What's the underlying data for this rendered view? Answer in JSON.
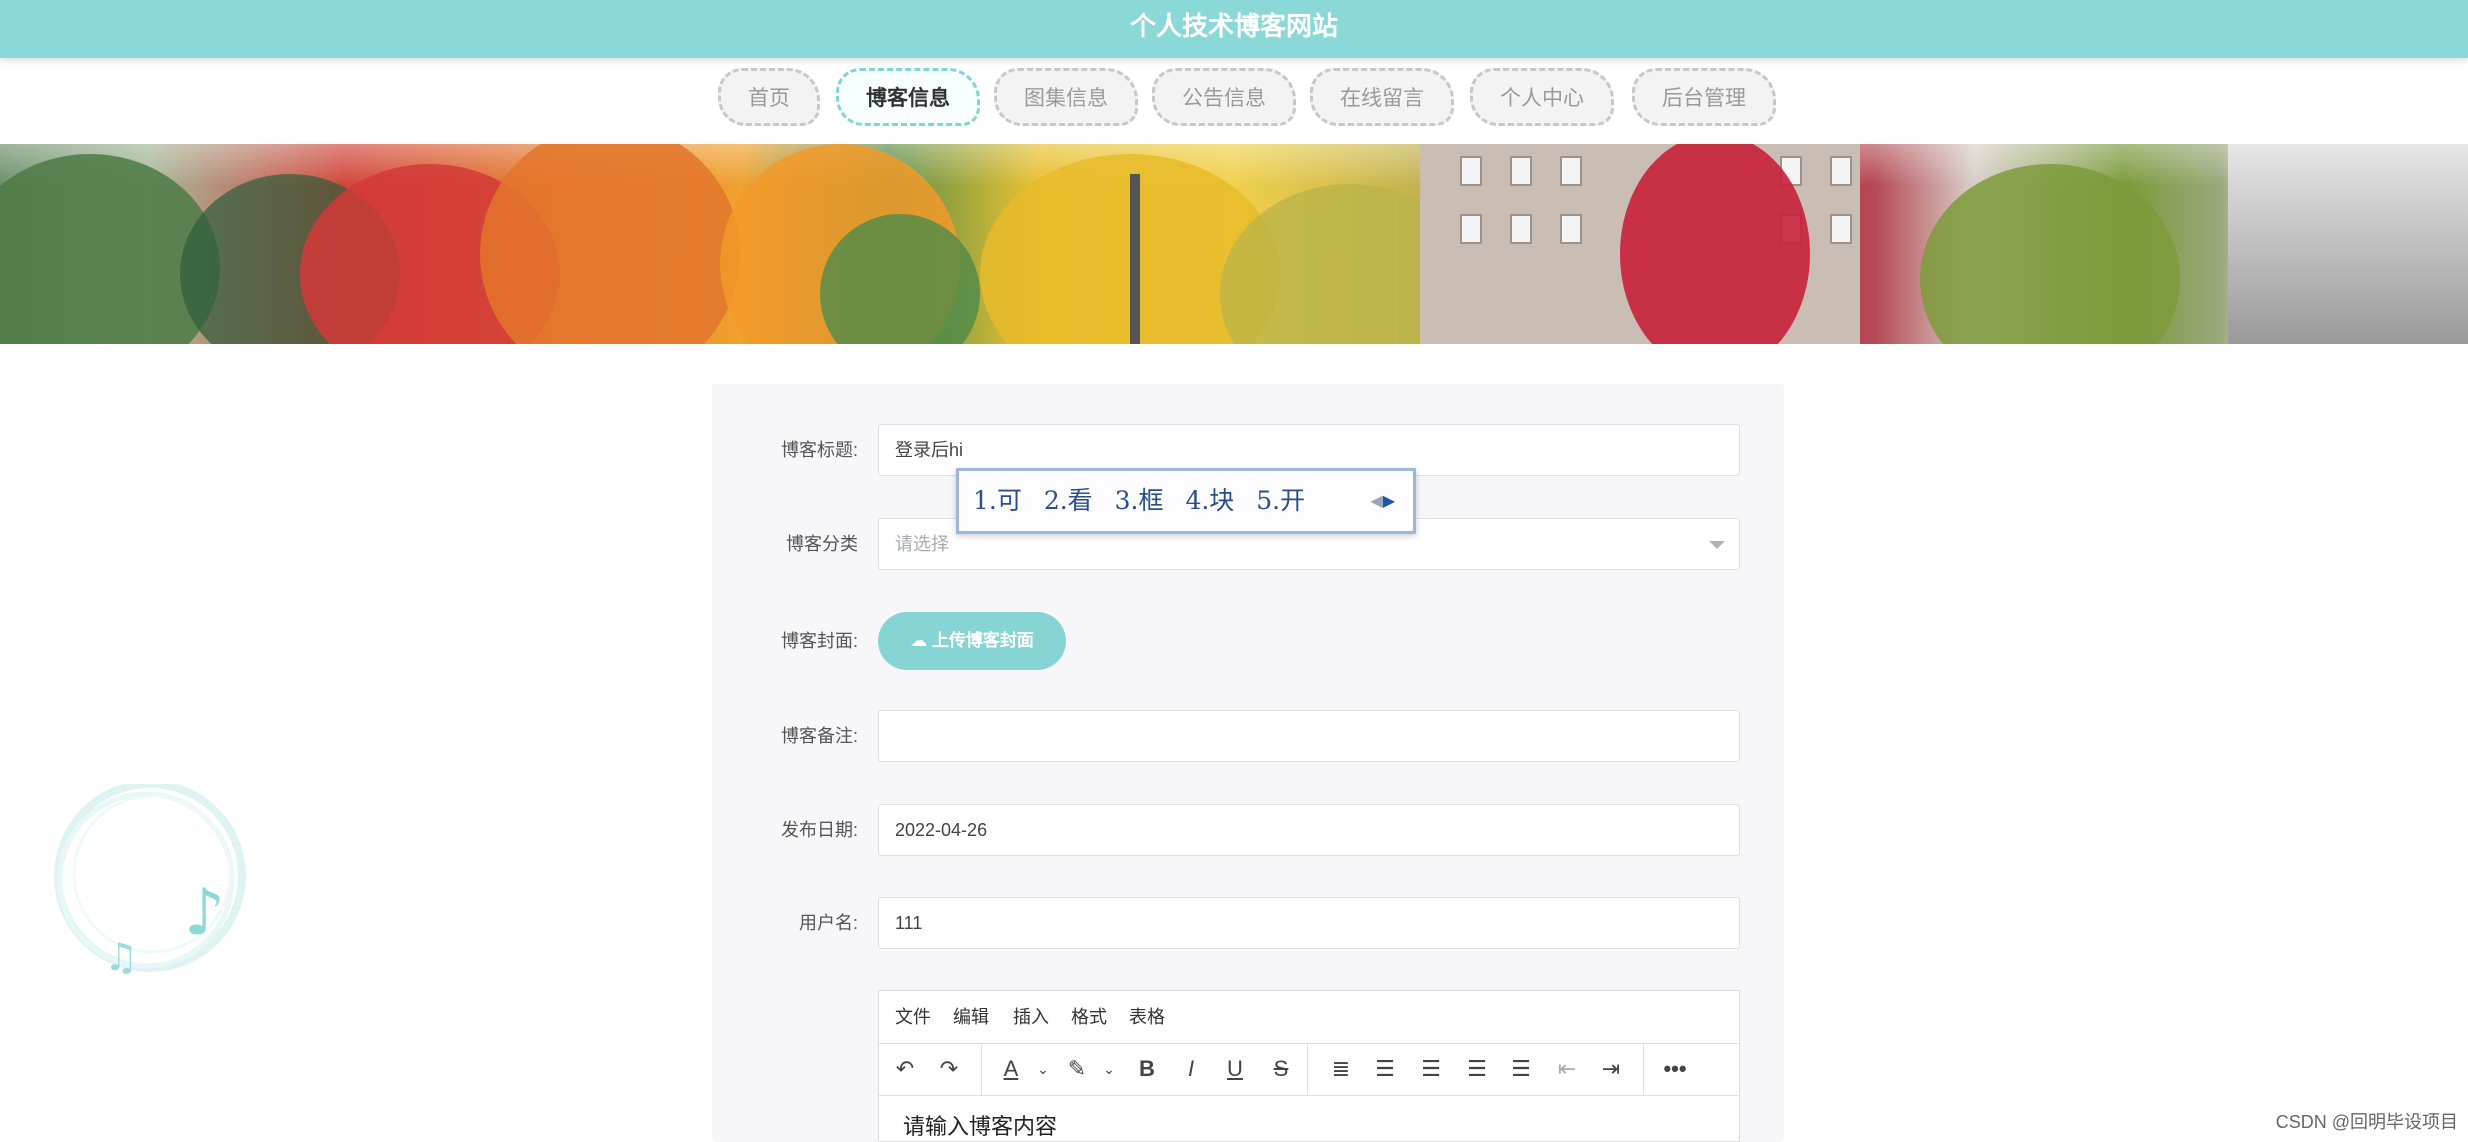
{
  "site": {
    "title": "个人技术博客网站"
  },
  "nav": {
    "items": [
      {
        "label": "首页"
      },
      {
        "label": "博客信息"
      },
      {
        "label": "图集信息"
      },
      {
        "label": "公告信息"
      },
      {
        "label": "在线留言"
      },
      {
        "label": "个人中心"
      },
      {
        "label": "后台管理"
      }
    ],
    "active": "博客信息"
  },
  "form": {
    "title": {
      "label": "博客标题:",
      "value": "登录后hi"
    },
    "category": {
      "label": "博客分类",
      "placeholder": "请选择"
    },
    "cover": {
      "label": "博客封面:",
      "button_label": "上传博客封面"
    },
    "remark": {
      "label": "博客备注:",
      "value": ""
    },
    "publish_date": {
      "label": "发布日期:",
      "value": "2022-04-26"
    },
    "username": {
      "label": "用户名:",
      "value": "111"
    }
  },
  "ime": {
    "candidates": [
      "1.可",
      "2.看",
      "3.框",
      "4.块",
      "5.开"
    ]
  },
  "editor": {
    "menu": [
      "文件",
      "编辑",
      "插入",
      "格式",
      "表格"
    ],
    "placeholder": "请输入博客内容",
    "toolbar_icons": [
      "undo-icon",
      "redo-icon",
      "font-color-icon",
      "highlight-icon",
      "bold-icon",
      "italic-icon",
      "underline-icon",
      "strikethrough-icon",
      "line-height-icon",
      "align-left-icon",
      "align-center-icon",
      "align-right-icon",
      "align-justify-icon",
      "outdent-icon",
      "indent-icon",
      "more-icon"
    ]
  },
  "watermark": "CSDN @回明毕设项目",
  "colors": {
    "accent": "#8ad8d8"
  }
}
